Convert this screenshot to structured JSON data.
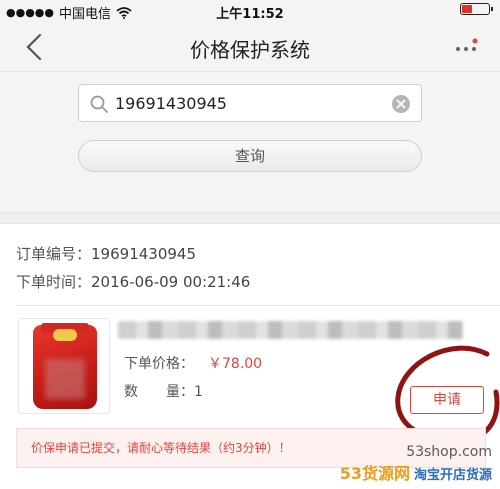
{
  "status_bar": {
    "signal": "●●●●●",
    "carrier": "中国电信",
    "time": "上午11:52",
    "battery_level": 0.35
  },
  "nav": {
    "title": "价格保护系统"
  },
  "search": {
    "value": "19691430945",
    "query_label": "查询"
  },
  "order": {
    "number_label": "订单编号：",
    "number": "19691430945",
    "time_label": "下单时间：",
    "time": "2016-06-09 00:21:46"
  },
  "product": {
    "price_label": "下单价格：",
    "price": "￥78.00",
    "qty_label_1": "数",
    "qty_label_2": "量：",
    "qty": "1",
    "apply_label": "申请"
  },
  "notice": {
    "text": "价保申请已提交，请耐心等待结果（约3分钟）！"
  },
  "watermark": {
    "site": "53shop.com",
    "brand": "53货源网",
    "sub": "淘宝开店货源"
  },
  "colors": {
    "accent": "#e2443a",
    "notice_bg": "#fdf1ef"
  }
}
